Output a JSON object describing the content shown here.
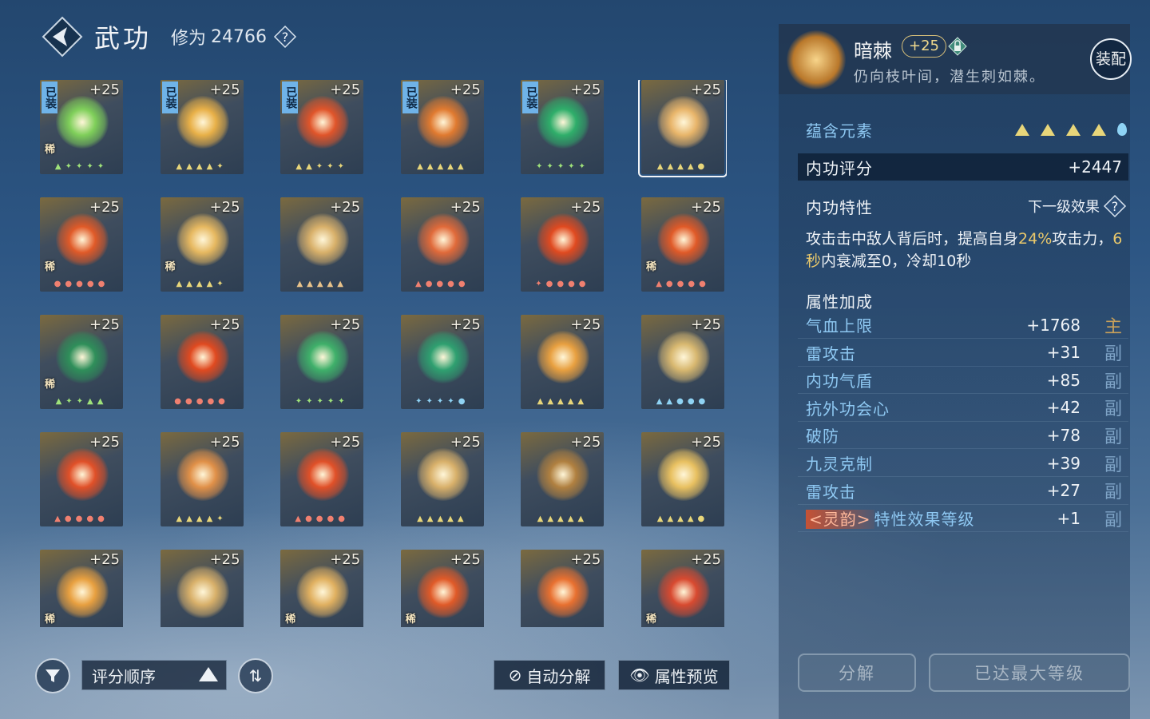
{
  "header": {
    "title": "武功",
    "xiuwei_label": "修为",
    "xiuwei_value": "24766",
    "help_symbol": "?"
  },
  "cards": [
    {
      "level": "+25",
      "equipped": true,
      "rare": true,
      "color": "#7fcf5a",
      "elems": "▲✦✦✦✦",
      "elem_color": "#9fe27a"
    },
    {
      "level": "+25",
      "equipped": true,
      "rare": false,
      "color": "#e8b048",
      "elems": "▲▲▲▲✦",
      "elem_color": "#e8d67a"
    },
    {
      "level": "+25",
      "equipped": true,
      "rare": false,
      "color": "#e0552a",
      "elems": "▲▲✦✦✦",
      "elem_color": "#e8d67a"
    },
    {
      "level": "+25",
      "equipped": true,
      "rare": false,
      "color": "#e07a30",
      "elems": "▲▲▲▲▲",
      "elem_color": "#e8d67a"
    },
    {
      "level": "+25",
      "equipped": true,
      "rare": false,
      "color": "#2fae6a",
      "elems": "✦✦✦✦✦",
      "elem_color": "#9fe27a"
    },
    {
      "level": "+25",
      "equipped": false,
      "rare": false,
      "selected": true,
      "color": "#e8b56a",
      "elems": "▲▲▲▲●",
      "elem_color": "#e8d67a"
    },
    {
      "level": "+25",
      "equipped": false,
      "rare": true,
      "color": "#e05a28",
      "elems": "●●●●●",
      "elem_color": "#f08070"
    },
    {
      "level": "+25",
      "equipped": false,
      "rare": true,
      "color": "#e6b860",
      "elems": "▲▲▲▲✦",
      "elem_color": "#e8d67a"
    },
    {
      "level": "+25",
      "equipped": false,
      "rare": false,
      "color": "#d8b06a",
      "elems": "▲▲▲▲▲",
      "elem_color": "#e8c28a"
    },
    {
      "level": "+25",
      "equipped": false,
      "rare": false,
      "color": "#e06a3a",
      "elems": "▲●●●●",
      "elem_color": "#f08070"
    },
    {
      "level": "+25",
      "equipped": false,
      "rare": false,
      "color": "#e04a20",
      "elems": "✦●●●●",
      "elem_color": "#f08070"
    },
    {
      "level": "+25",
      "equipped": false,
      "rare": true,
      "color": "#e05a28",
      "elems": "▲●●●●",
      "elem_color": "#f08070"
    },
    {
      "level": "+25",
      "equipped": false,
      "rare": true,
      "color": "#2f8f5a",
      "elems": "▲✦✦▲▲",
      "elem_color": "#9fe27a"
    },
    {
      "level": "+25",
      "equipped": false,
      "rare": false,
      "color": "#e04a20",
      "elems": "●●●●●",
      "elem_color": "#f08070"
    },
    {
      "level": "+25",
      "equipped": false,
      "rare": false,
      "color": "#3fb06a",
      "elems": "✦✦✦✦✦",
      "elem_color": "#9fe27a"
    },
    {
      "level": "+25",
      "equipped": false,
      "rare": false,
      "color": "#2fa070",
      "elems": "✦✦✦✦●",
      "elem_color": "#8fd3f4"
    },
    {
      "level": "+25",
      "equipped": false,
      "rare": false,
      "color": "#e8a040",
      "elems": "▲▲▲▲▲",
      "elem_color": "#e8d67a"
    },
    {
      "level": "+25",
      "equipped": false,
      "rare": false,
      "color": "#d8b870",
      "elems": "▲▲●●●",
      "elem_color": "#8fd3f4"
    },
    {
      "level": "+25",
      "equipped": false,
      "rare": false,
      "color": "#e05028",
      "elems": "▲●●●●",
      "elem_color": "#f08070"
    },
    {
      "level": "+25",
      "equipped": false,
      "rare": false,
      "color": "#e09048",
      "elems": "▲▲▲▲✦",
      "elem_color": "#e8d67a"
    },
    {
      "level": "+25",
      "equipped": false,
      "rare": false,
      "color": "#e05028",
      "elems": "▲●●●●",
      "elem_color": "#f08070"
    },
    {
      "level": "+25",
      "equipped": false,
      "rare": false,
      "color": "#d8b06a",
      "elems": "▲▲▲▲▲",
      "elem_color": "#e8d67a"
    },
    {
      "level": "+25",
      "equipped": false,
      "rare": false,
      "color": "#b08040",
      "elems": "▲▲▲▲▲",
      "elem_color": "#e8d67a"
    },
    {
      "level": "+25",
      "equipped": false,
      "rare": false,
      "color": "#e8c060",
      "elems": "▲▲▲▲●",
      "elem_color": "#e8d67a"
    },
    {
      "level": "+25",
      "equipped": false,
      "rare": true,
      "color": "#e8a040",
      "elems": "",
      "elem_color": "#e8d67a"
    },
    {
      "level": "+25",
      "equipped": false,
      "rare": false,
      "color": "#d8b06a",
      "elems": "",
      "elem_color": "#e8d67a"
    },
    {
      "level": "+25",
      "equipped": false,
      "rare": true,
      "color": "#e0b060",
      "elems": "",
      "elem_color": "#e8d67a"
    },
    {
      "level": "+25",
      "equipped": false,
      "rare": true,
      "color": "#e05a28",
      "elems": "",
      "elem_color": "#e8d67a"
    },
    {
      "level": "+25",
      "equipped": false,
      "rare": false,
      "color": "#e87030",
      "elems": "",
      "elem_color": "#e8d67a"
    },
    {
      "level": "+25",
      "equipped": false,
      "rare": true,
      "color": "#d84a30",
      "elems": "",
      "elem_color": "#e8d67a"
    }
  ],
  "card_labels": {
    "equipped": "已装",
    "rare": "稀"
  },
  "bottom": {
    "sort_label": "评分顺序",
    "auto_decompose": "自动分解",
    "attr_preview": "属性预览"
  },
  "panel": {
    "name": "暗棘",
    "level": "+25",
    "desc": "仍向枝叶间，潜生刺如棘。",
    "equip_label": "装配",
    "elements_label": "蕴含元素",
    "score_label": "内功评分",
    "score_value": "+2447",
    "trait_label": "内功特性",
    "next_effect": "下一级效果",
    "trait_text_a": "攻击击中敌人背后时，提高自身",
    "trait_hl1": "24%",
    "trait_text_b": "攻击力，",
    "trait_hl2": "6秒",
    "trait_text_c": "内衰减至0，冷却10秒",
    "attr_title": "属性加成",
    "attrs": [
      {
        "name": "气血上限",
        "value": "+1768",
        "tag": "主"
      },
      {
        "name": "雷攻击",
        "value": "+31",
        "tag": "副"
      },
      {
        "name": "内功气盾",
        "value": "+85",
        "tag": "副"
      },
      {
        "name": "抗外功会心",
        "value": "+42",
        "tag": "副"
      },
      {
        "name": "破防",
        "value": "+78",
        "tag": "副"
      },
      {
        "name": "九灵克制",
        "value": "+39",
        "tag": "副"
      },
      {
        "name": "雷攻击",
        "value": "+27",
        "tag": "副"
      }
    ],
    "special_attr": {
      "prefix": "<灵韵>",
      "name": "特性效果等级",
      "value": "+1",
      "tag": "副"
    },
    "decompose_label": "分解",
    "max_level_label": "已达最大等级"
  }
}
